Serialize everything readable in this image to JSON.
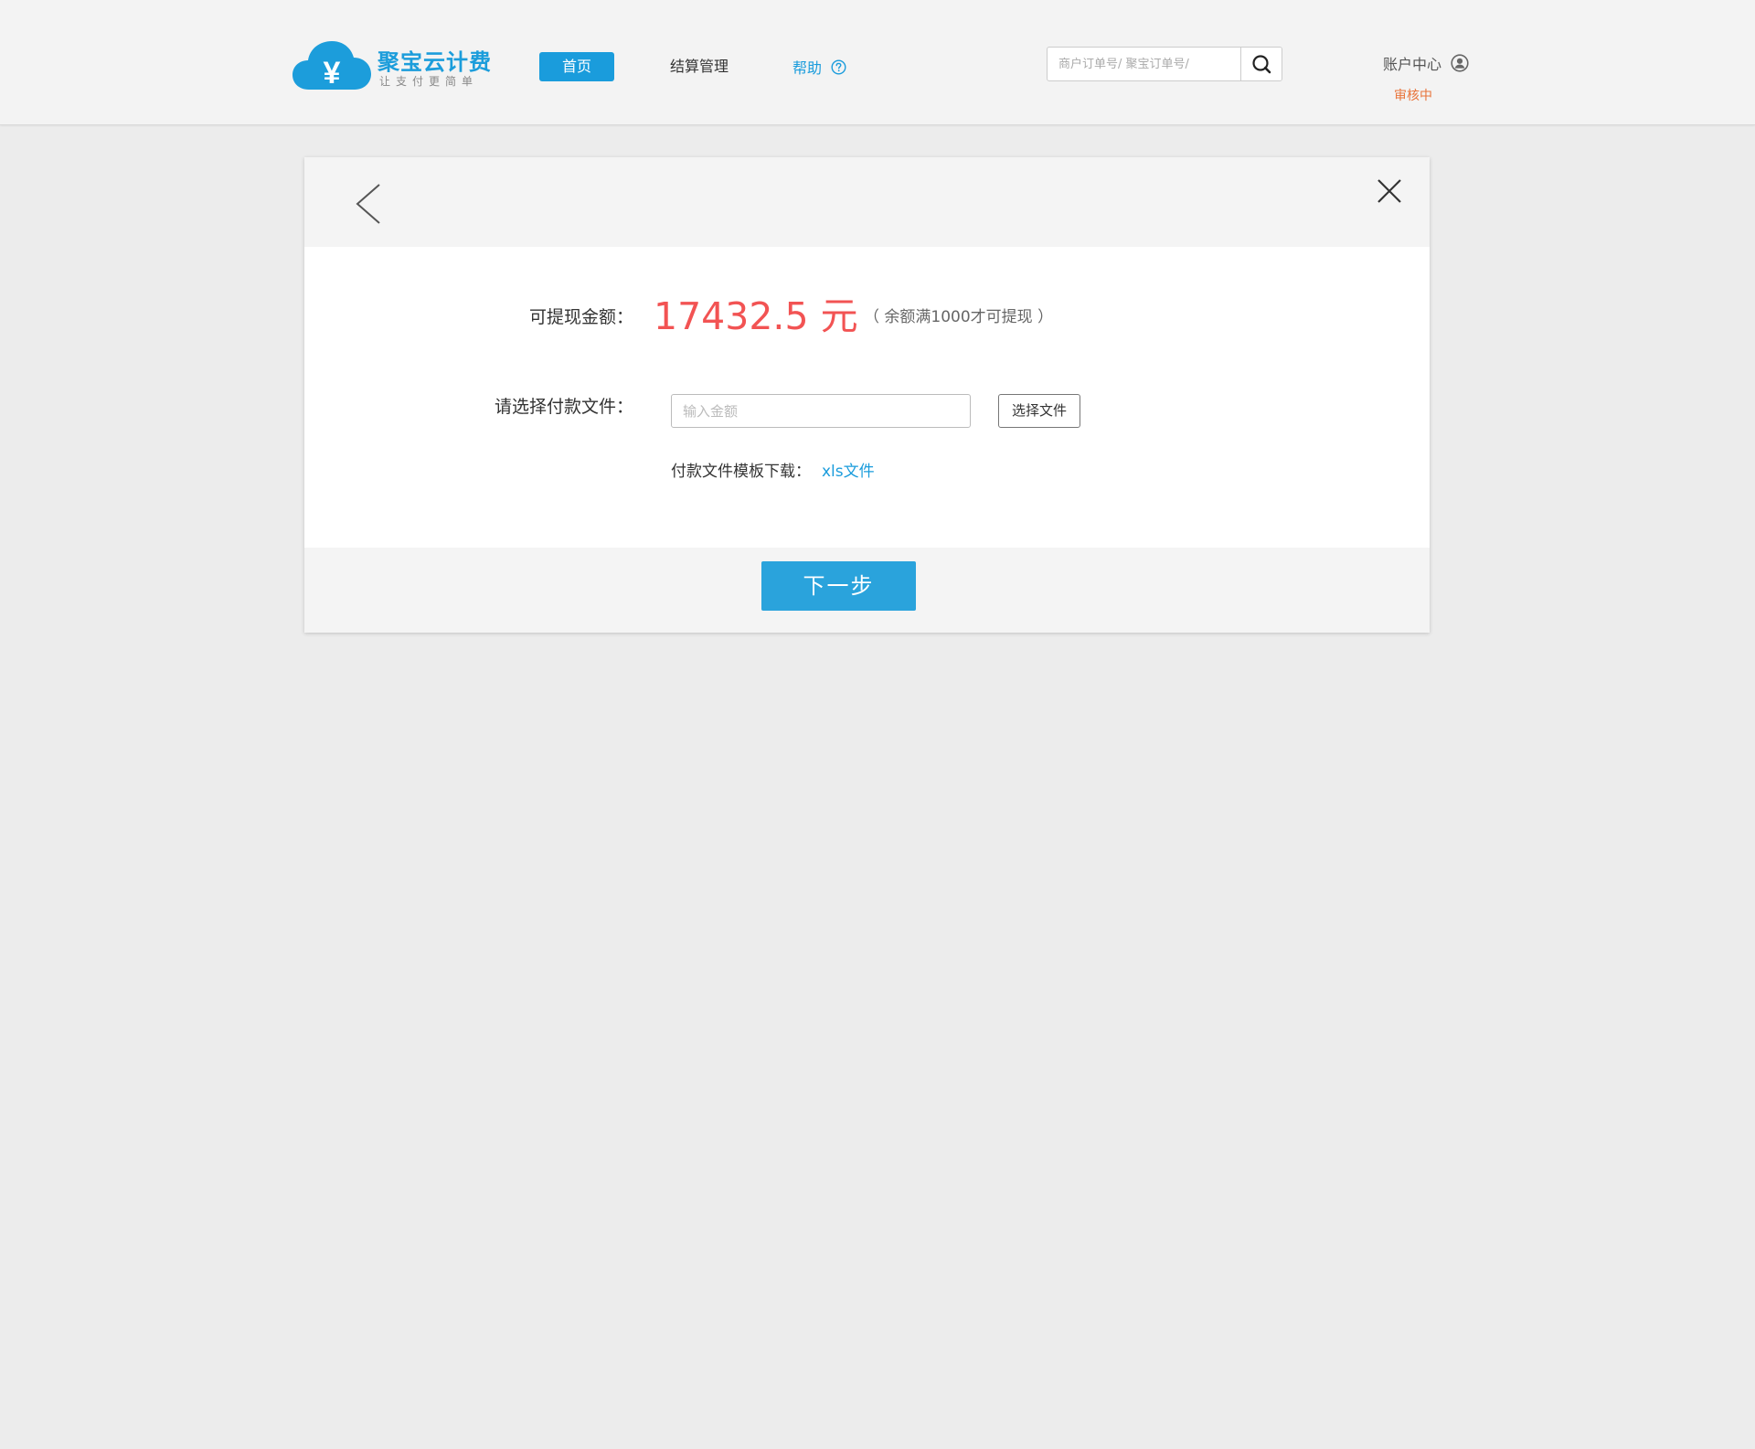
{
  "brand": {
    "title": "聚宝云计费",
    "slogan": "让支付更简单",
    "color": "#1c9ddb"
  },
  "nav": {
    "home": "首页",
    "settlement": "结算管理",
    "help": "帮助"
  },
  "search": {
    "placeholder": "商户订单号/ 聚宝订单号/",
    "icon": "search-icon"
  },
  "account": {
    "label": "账户中心",
    "status": "审核中",
    "status_color": "#e8743b"
  },
  "dialog": {
    "amount_label": "可提现金额：",
    "amount_value": "17432.5 元",
    "amount_note": "（ 余额满1000才可提现 ）",
    "file_label": "请选择付款文件：",
    "amount_input_placeholder": "输入金额",
    "choose_button": "选择文件",
    "template_label": "付款文件模板下载：",
    "template_link": "xls文件",
    "next_button": "下一步",
    "accent_color": "#2aa3dc",
    "amount_color": "#f25353"
  }
}
